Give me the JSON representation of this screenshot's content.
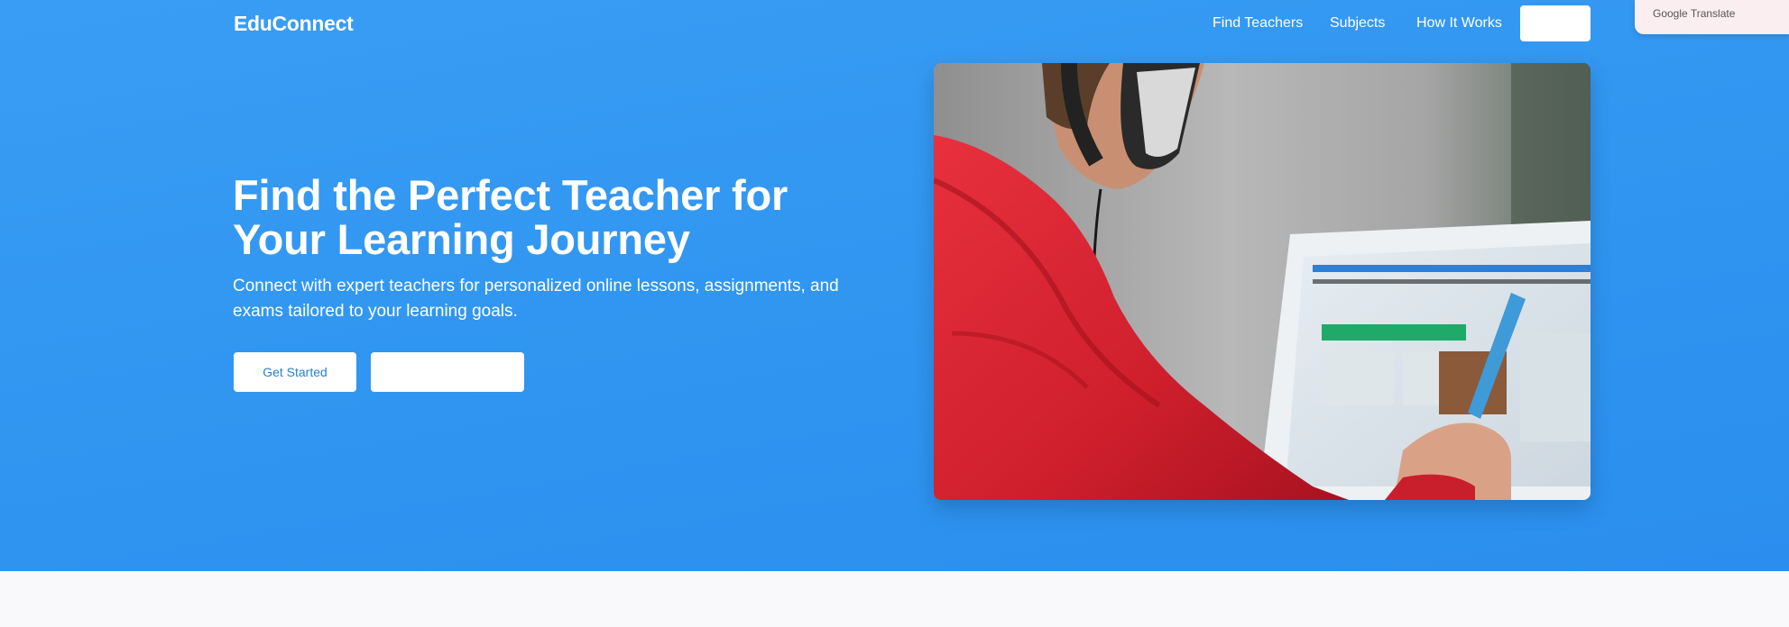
{
  "header": {
    "brand": "EduConnect",
    "nav": [
      "Find Teachers",
      "Subjects",
      "How It Works"
    ],
    "cta_label": ""
  },
  "hero": {
    "title_line1": "Find the Perfect Teacher for",
    "title_line2": "Your Learning Journey",
    "subtitle": "Connect with expert teachers for personalized online lessons, assignments, and exams tailored to your learning goals.",
    "primary_button": "Get Started",
    "secondary_button": ""
  },
  "translate_widget": {
    "label": "Google Translate"
  },
  "colors": {
    "hero_background": "#2f95f0",
    "button_text": "#2580da",
    "page_background": "#f9f9fb"
  }
}
